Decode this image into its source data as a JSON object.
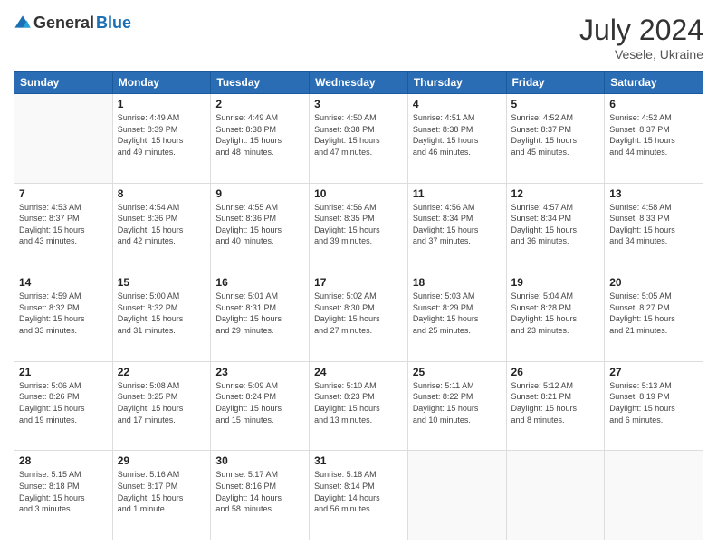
{
  "header": {
    "logo_general": "General",
    "logo_blue": "Blue",
    "title": "July 2024",
    "location": "Vesele, Ukraine"
  },
  "days_of_week": [
    "Sunday",
    "Monday",
    "Tuesday",
    "Wednesday",
    "Thursday",
    "Friday",
    "Saturday"
  ],
  "weeks": [
    [
      {
        "day": "",
        "info": ""
      },
      {
        "day": "1",
        "info": "Sunrise: 4:49 AM\nSunset: 8:39 PM\nDaylight: 15 hours\nand 49 minutes."
      },
      {
        "day": "2",
        "info": "Sunrise: 4:49 AM\nSunset: 8:38 PM\nDaylight: 15 hours\nand 48 minutes."
      },
      {
        "day": "3",
        "info": "Sunrise: 4:50 AM\nSunset: 8:38 PM\nDaylight: 15 hours\nand 47 minutes."
      },
      {
        "day": "4",
        "info": "Sunrise: 4:51 AM\nSunset: 8:38 PM\nDaylight: 15 hours\nand 46 minutes."
      },
      {
        "day": "5",
        "info": "Sunrise: 4:52 AM\nSunset: 8:37 PM\nDaylight: 15 hours\nand 45 minutes."
      },
      {
        "day": "6",
        "info": "Sunrise: 4:52 AM\nSunset: 8:37 PM\nDaylight: 15 hours\nand 44 minutes."
      }
    ],
    [
      {
        "day": "7",
        "info": "Sunrise: 4:53 AM\nSunset: 8:37 PM\nDaylight: 15 hours\nand 43 minutes."
      },
      {
        "day": "8",
        "info": "Sunrise: 4:54 AM\nSunset: 8:36 PM\nDaylight: 15 hours\nand 42 minutes."
      },
      {
        "day": "9",
        "info": "Sunrise: 4:55 AM\nSunset: 8:36 PM\nDaylight: 15 hours\nand 40 minutes."
      },
      {
        "day": "10",
        "info": "Sunrise: 4:56 AM\nSunset: 8:35 PM\nDaylight: 15 hours\nand 39 minutes."
      },
      {
        "day": "11",
        "info": "Sunrise: 4:56 AM\nSunset: 8:34 PM\nDaylight: 15 hours\nand 37 minutes."
      },
      {
        "day": "12",
        "info": "Sunrise: 4:57 AM\nSunset: 8:34 PM\nDaylight: 15 hours\nand 36 minutes."
      },
      {
        "day": "13",
        "info": "Sunrise: 4:58 AM\nSunset: 8:33 PM\nDaylight: 15 hours\nand 34 minutes."
      }
    ],
    [
      {
        "day": "14",
        "info": "Sunrise: 4:59 AM\nSunset: 8:32 PM\nDaylight: 15 hours\nand 33 minutes."
      },
      {
        "day": "15",
        "info": "Sunrise: 5:00 AM\nSunset: 8:32 PM\nDaylight: 15 hours\nand 31 minutes."
      },
      {
        "day": "16",
        "info": "Sunrise: 5:01 AM\nSunset: 8:31 PM\nDaylight: 15 hours\nand 29 minutes."
      },
      {
        "day": "17",
        "info": "Sunrise: 5:02 AM\nSunset: 8:30 PM\nDaylight: 15 hours\nand 27 minutes."
      },
      {
        "day": "18",
        "info": "Sunrise: 5:03 AM\nSunset: 8:29 PM\nDaylight: 15 hours\nand 25 minutes."
      },
      {
        "day": "19",
        "info": "Sunrise: 5:04 AM\nSunset: 8:28 PM\nDaylight: 15 hours\nand 23 minutes."
      },
      {
        "day": "20",
        "info": "Sunrise: 5:05 AM\nSunset: 8:27 PM\nDaylight: 15 hours\nand 21 minutes."
      }
    ],
    [
      {
        "day": "21",
        "info": "Sunrise: 5:06 AM\nSunset: 8:26 PM\nDaylight: 15 hours\nand 19 minutes."
      },
      {
        "day": "22",
        "info": "Sunrise: 5:08 AM\nSunset: 8:25 PM\nDaylight: 15 hours\nand 17 minutes."
      },
      {
        "day": "23",
        "info": "Sunrise: 5:09 AM\nSunset: 8:24 PM\nDaylight: 15 hours\nand 15 minutes."
      },
      {
        "day": "24",
        "info": "Sunrise: 5:10 AM\nSunset: 8:23 PM\nDaylight: 15 hours\nand 13 minutes."
      },
      {
        "day": "25",
        "info": "Sunrise: 5:11 AM\nSunset: 8:22 PM\nDaylight: 15 hours\nand 10 minutes."
      },
      {
        "day": "26",
        "info": "Sunrise: 5:12 AM\nSunset: 8:21 PM\nDaylight: 15 hours\nand 8 minutes."
      },
      {
        "day": "27",
        "info": "Sunrise: 5:13 AM\nSunset: 8:19 PM\nDaylight: 15 hours\nand 6 minutes."
      }
    ],
    [
      {
        "day": "28",
        "info": "Sunrise: 5:15 AM\nSunset: 8:18 PM\nDaylight: 15 hours\nand 3 minutes."
      },
      {
        "day": "29",
        "info": "Sunrise: 5:16 AM\nSunset: 8:17 PM\nDaylight: 15 hours\nand 1 minute."
      },
      {
        "day": "30",
        "info": "Sunrise: 5:17 AM\nSunset: 8:16 PM\nDaylight: 14 hours\nand 58 minutes."
      },
      {
        "day": "31",
        "info": "Sunrise: 5:18 AM\nSunset: 8:14 PM\nDaylight: 14 hours\nand 56 minutes."
      },
      {
        "day": "",
        "info": ""
      },
      {
        "day": "",
        "info": ""
      },
      {
        "day": "",
        "info": ""
      }
    ]
  ]
}
